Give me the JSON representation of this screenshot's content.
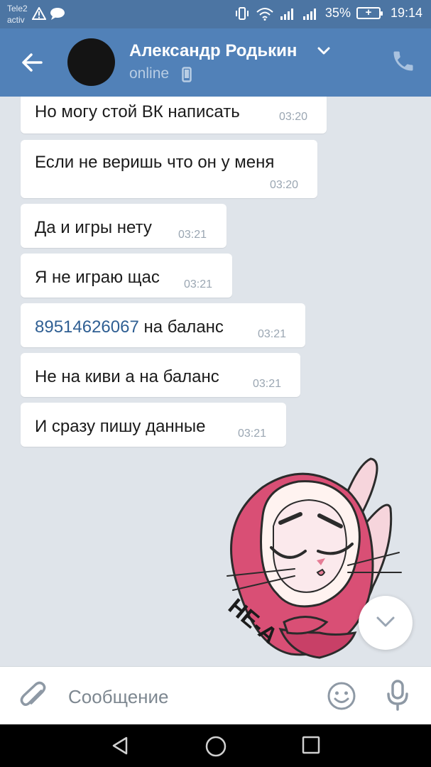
{
  "status_bar": {
    "carrier_line1": "Tele2",
    "carrier_line2": "activ",
    "battery_percent": "35%",
    "time": "19:14",
    "icons": [
      "warning-icon",
      "chat-notification-icon",
      "vibrate-icon",
      "wifi-icon",
      "signal-icon",
      "signal-icon",
      "battery-charging-icon"
    ]
  },
  "header": {
    "contact_name": "Александр Родькин",
    "status": "online",
    "colors": {
      "bar": "#5181b8",
      "status_text": "#b8cde4"
    }
  },
  "messages": [
    {
      "text": "Но могу стой ВК написать",
      "time": "03:20"
    },
    {
      "text": "Если не веришь что он у меня",
      "time": "03:20"
    },
    {
      "text": "Да и игры нету",
      "time": "03:21"
    },
    {
      "text": "Я не играю щас",
      "time": "03:21"
    },
    {
      "link": "89514626067",
      "text": " на баланс",
      "time": "03:21"
    },
    {
      "text": "Не на киви а на баланс",
      "time": "03:21"
    },
    {
      "text": "И сразу пишу данные",
      "time": "03:21"
    }
  ],
  "sticker": {
    "caption": "HE-A"
  },
  "input": {
    "placeholder": "Сообщение"
  },
  "colors": {
    "background": "#dfe4ea",
    "link": "#2f5f93",
    "accent": "#5181b8"
  }
}
